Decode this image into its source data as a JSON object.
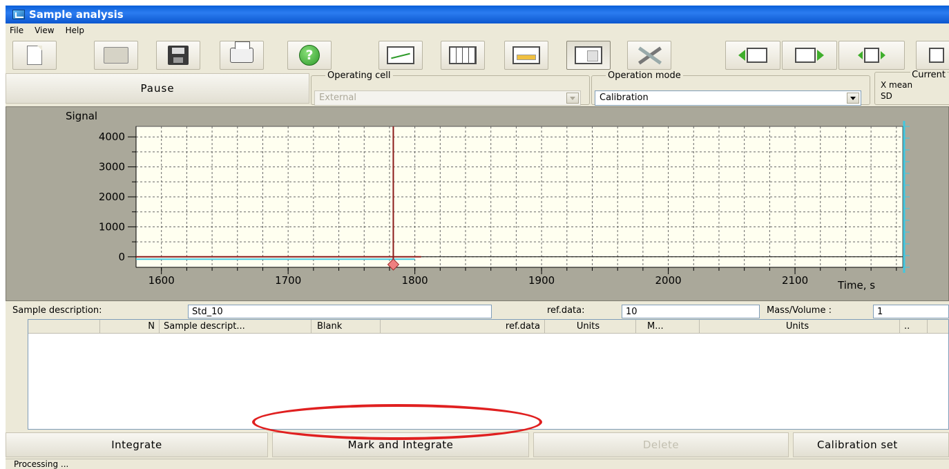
{
  "window": {
    "title": "Sample analysis"
  },
  "menu": [
    "File",
    "View",
    "Help"
  ],
  "toolbar": {
    "icons": [
      "new-doc-icon",
      "open-folder-icon",
      "save-disk-icon",
      "print-icon",
      "help-icon",
      "chart-view-icon",
      "table-view-icon",
      "panel-view-icon",
      "layout-view-icon",
      "tools-icon",
      "prev-chart-icon",
      "next-chart-icon",
      "move-icon"
    ],
    "help_glyph": "?"
  },
  "controls": {
    "pause_label": "Pause",
    "operating_cell": {
      "legend": "Operating cell",
      "value": "External"
    },
    "operation_mode": {
      "legend": "Operation mode",
      "value": "Calibration"
    },
    "current": {
      "title": "Current",
      "row1": "X mean",
      "row2": "SD"
    }
  },
  "chart_data": {
    "type": "line",
    "ylabel": "Signal",
    "xlabel": "Time, s",
    "xlim": [
      1580,
      2185
    ],
    "ylim": [
      -350,
      4350
    ],
    "x_ticks": [
      1600,
      1700,
      1800,
      1900,
      2000,
      2100
    ],
    "y_ticks": [
      0,
      1000,
      2000,
      3000,
      4000
    ],
    "cursor_x": 1783,
    "series": [
      {
        "color": "#8b1a1a",
        "x": [
          1580,
          1805
        ],
        "y": [
          0,
          0
        ]
      },
      {
        "color": "#40c8e0",
        "x": [
          1580,
          1800
        ],
        "y": [
          -80,
          -80
        ]
      }
    ],
    "grid": true,
    "background": "#fffff0"
  },
  "sample": {
    "desc_label": "Sample description:",
    "desc_value": "Std_10",
    "ref_label": "ref.data:",
    "ref_value": "10",
    "mass_label": "Mass/Volume :",
    "mass_value": "1"
  },
  "table": {
    "columns": [
      "N",
      "Sample descript...",
      "Blank",
      "ref.data",
      "Units",
      "M...",
      "Units",
      ".."
    ]
  },
  "buttons": {
    "integrate": "Integrate",
    "mark_integrate": "Mark and Integrate",
    "delete": "Delete",
    "calibration": "Calibration set"
  },
  "status": {
    "text": "Processing ..."
  }
}
